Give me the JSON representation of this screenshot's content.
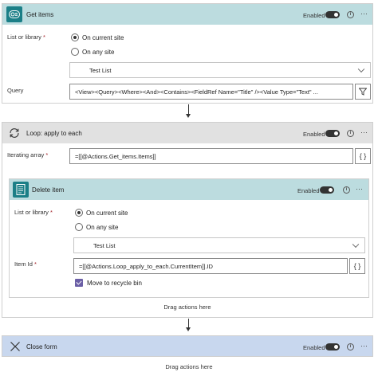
{
  "get_items": {
    "title": "Get items",
    "enabled_label": "Enabled",
    "list_label": "List or library",
    "required_mark": "*",
    "radio_current": "On current site",
    "radio_any": "On any site",
    "list_value": "Test List",
    "query_label": "Query",
    "query_value": "<View><Query><Where><And><Contains><FieldRef Name=\"Title\" /><Value Type=\"Text\" ..."
  },
  "loop": {
    "title": "Loop: apply to each",
    "enabled_label": "Enabled",
    "iterating_label": "Iterating array",
    "required_mark": "*",
    "iterating_value": "=[[@Actions.Get_items.Items]]",
    "fx_button": "{ }"
  },
  "delete_item": {
    "title": "Delete item",
    "enabled_label": "Enabled",
    "list_label": "List or library",
    "required_mark": "*",
    "radio_current": "On current site",
    "radio_any": "On any site",
    "list_value": "Test List",
    "item_id_label": "Item Id",
    "item_id_value": "=[[@Actions.Loop_apply_to_each.CurrentItem]].ID",
    "fx_button": "{ }",
    "recycle_label": "Move to recycle bin",
    "recycle_checked": true
  },
  "loop_drag_text": "Drag actions here",
  "close_form": {
    "title": "Close form",
    "enabled_label": "Enabled"
  },
  "bottom_drag_text": "Drag actions here",
  "more_glyph": "···",
  "info_glyph": "i",
  "colors": {
    "teal_header": "#bcdcdf",
    "gray_header": "#e1e1e1",
    "blue_header": "#c8d7ee",
    "teal_icon": "#1b7f87",
    "checkbox": "#6b5fa6"
  }
}
